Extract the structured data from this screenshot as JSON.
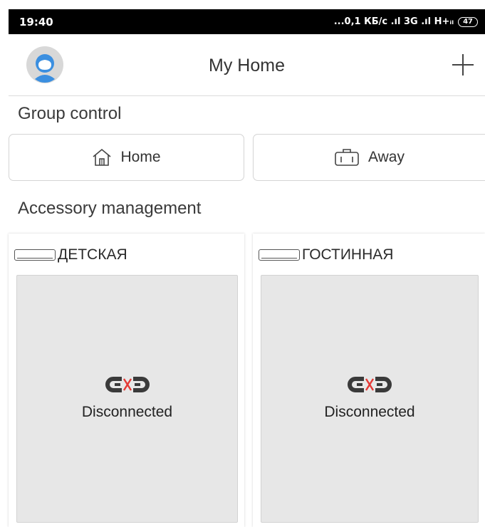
{
  "status_bar": {
    "time": "19:40",
    "network": "...0,1 КБ/с .ıl 3G .ıl H+ᵢₗ",
    "battery": "47"
  },
  "header": {
    "title": "My Home"
  },
  "group_control": {
    "label": "Group control",
    "buttons": [
      {
        "label": "Home",
        "icon": "home-icon"
      },
      {
        "label": "Away",
        "icon": "briefcase-icon"
      }
    ]
  },
  "accessory_management": {
    "label": "Accessory management",
    "devices": [
      {
        "name": "ДЕТСКАЯ",
        "icon": "air-conditioner-icon",
        "status": "Disconnected"
      },
      {
        "name": "ГОСТИННАЯ",
        "icon": "air-conditioner-icon",
        "status": "Disconnected"
      }
    ]
  },
  "colors": {
    "disconnect_red": "#e53935",
    "icon_dark": "#3a3a3a",
    "avatar_blue": "#3b8fe0",
    "card_body": "#e7e7e7"
  }
}
